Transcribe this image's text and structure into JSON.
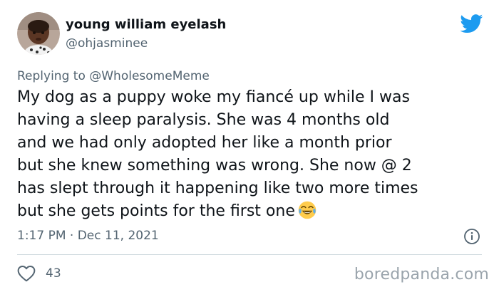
{
  "tweet": {
    "display_name": "young william eyelash",
    "handle": "@ohjasminee",
    "reply_prefix": "Replying to",
    "reply_to": "@WholesomeMeme",
    "body_lines": [
      "My dog as a puppy woke my fiancé up while I was",
      "having a sleep paralysis. She was 4 months old",
      "and we had only adopted her like a month prior",
      "but she knew something was wrong. She now @ 2",
      "has slept through it happening like two more times",
      "but she gets points for the first one"
    ],
    "emoji": "face-with-tears-of-joy",
    "timestamp": "1:17 PM · Dec 11, 2021",
    "like_count": "43"
  },
  "watermark": "boredpanda.com",
  "icons": {
    "brand": "twitter-bird-icon",
    "info": "info-icon",
    "like": "heart-icon",
    "avatar": "avatar-photo"
  },
  "colors": {
    "twitter_blue": "#1d9bf0",
    "secondary_text": "#536471",
    "primary_text": "#0f1419",
    "divider": "#cfd9de",
    "watermark": "#9aa4ac"
  }
}
